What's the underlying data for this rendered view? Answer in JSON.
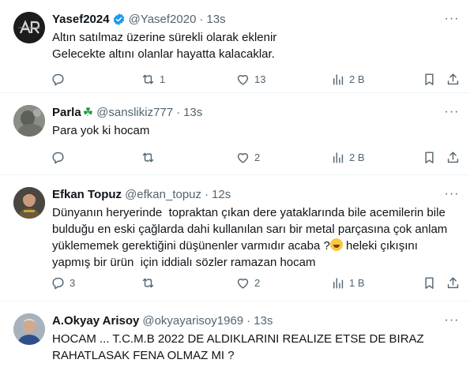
{
  "tweets": [
    {
      "name": "Yasef2024",
      "verified": true,
      "handle": "@Yasef2020",
      "dot": "·",
      "time": "13s",
      "lines": [
        "Altın satılmaz üzerine sürekli olarak eklenir",
        "Gelecekte altını olanlar hayatta kalacaklar."
      ],
      "reply_count": "",
      "retweet_count": "1",
      "like_count": "13",
      "view_count": "2 B",
      "avatar_icon": "ar-logo-avatar"
    },
    {
      "name": "Parla",
      "name_emoji": "☘",
      "handle": "@sanslikiz777",
      "dot": "·",
      "time": "13s",
      "lines": [
        "Para yok ki hocam"
      ],
      "reply_count": "",
      "retweet_count": "",
      "like_count": "2",
      "view_count": "2 B",
      "avatar_icon": "gray-photo-avatar"
    },
    {
      "name": "Efkan Topuz",
      "handle": "@efkan_topuz",
      "dot": "·",
      "time": "12s",
      "lines": [
        "Dünyanın heryerinde  topraktan çıkan dere yataklarında bile acemilerin bile",
        "bulduğu en eski çağlarda dahi kullanılan sarı bir metal parçasına çok anlam"
      ],
      "line3_before": "yüklememek gerektiğini düşünenler varmıdır acaba ?",
      "line3_after": " heleki çıkışını",
      "line4": "yapmış bir ürün  için iddialı sözler ramazan hocam",
      "reply_count": "3",
      "retweet_count": "",
      "like_count": "2",
      "view_count": "1 B",
      "avatar_icon": "person-photo-avatar"
    },
    {
      "name": "A.Okyay Arisoy",
      "handle": "@okyayarisoy1969",
      "dot": "·",
      "time": "13s",
      "lines": [
        "HOCAM ... T.C.M.B 2022 DE ALDIKLARINI REALIZE ETSE DE BIRAZ",
        "RAHATLASAK FENA OLMAZ MI ?"
      ],
      "avatar_icon": "person-photo-avatar"
    }
  ],
  "colors": {
    "text": "#0f1419",
    "secondary": "#536471",
    "verified": "#1d9bf0",
    "divider": "#eff3f4"
  }
}
